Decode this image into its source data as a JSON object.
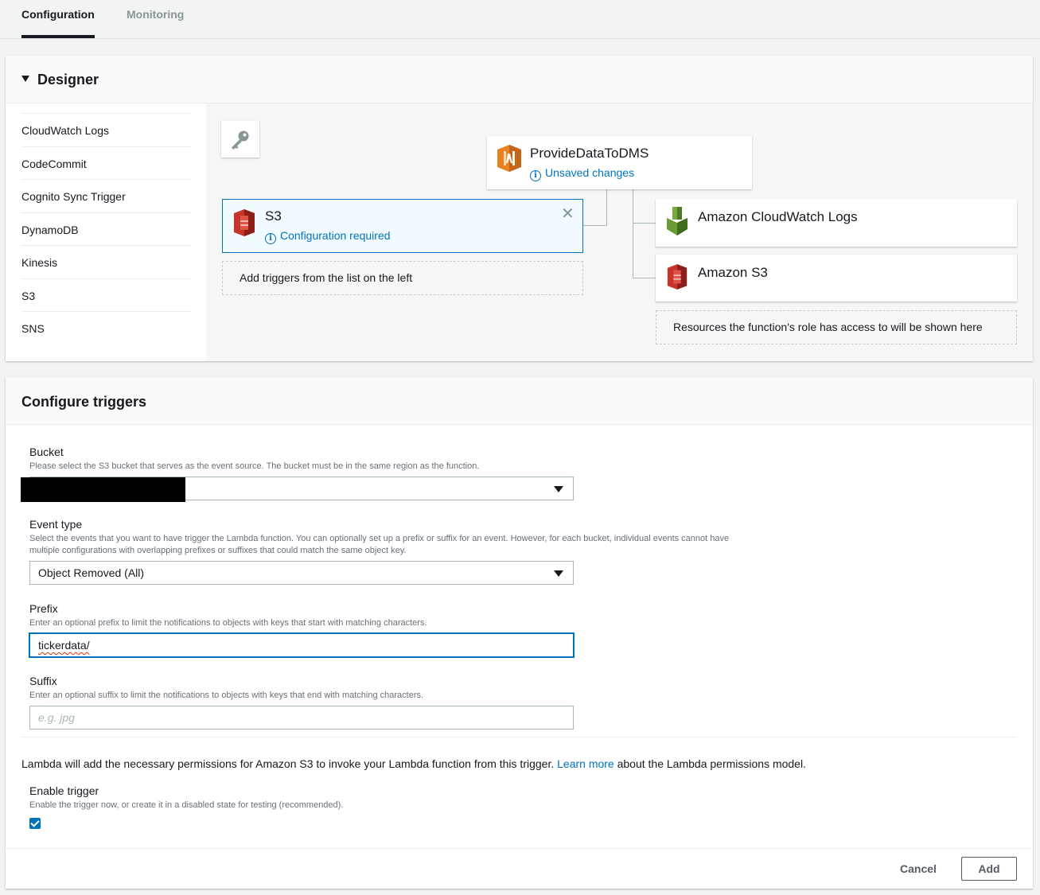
{
  "tabs": [
    {
      "label": "Configuration",
      "active": true
    },
    {
      "label": "Monitoring",
      "active": false
    }
  ],
  "designer": {
    "title": "Designer",
    "triggers": [
      "CloudWatch Logs",
      "CodeCommit",
      "Cognito Sync Trigger",
      "DynamoDB",
      "Kinesis",
      "S3",
      "SNS"
    ],
    "function": {
      "name": "ProvideDataToDMS",
      "status": "Unsaved changes"
    },
    "trigger_card": {
      "name": "S3",
      "status": "Configuration required"
    },
    "add_triggers_hint": "Add triggers from the list on the left",
    "resources": [
      "Amazon CloudWatch Logs",
      "Amazon S3"
    ],
    "resources_hint": "Resources the function's role has access to will be shown here"
  },
  "configure": {
    "title": "Configure triggers",
    "bucket": {
      "label": "Bucket",
      "desc": "Please select the S3 bucket that serves as the event source. The bucket must be in the same region as the function.",
      "value": ""
    },
    "event_type": {
      "label": "Event type",
      "desc": "Select the events that you want to have trigger the Lambda function. You can optionally set up a prefix or suffix for an event. However, for each bucket, individual events cannot have multiple configurations with overlapping prefixes or suffixes that could match the same object key.",
      "value": "Object Removed (All)"
    },
    "prefix": {
      "label": "Prefix",
      "desc": "Enter an optional prefix to limit the notifications to objects with keys that start with matching characters.",
      "value": "tickerdata/"
    },
    "suffix": {
      "label": "Suffix",
      "desc": "Enter an optional suffix to limit the notifications to objects with keys that end with matching characters.",
      "placeholder": "e.g. jpg"
    },
    "permissions": {
      "before": "Lambda will add the necessary permissions for Amazon S3 to invoke your Lambda function from this trigger. ",
      "link": "Learn more",
      "after": " about the Lambda permissions model."
    },
    "enable_trigger": {
      "label": "Enable trigger",
      "desc": "Enable the trigger now, or create it in a disabled state for testing (recommended).",
      "checked": true
    },
    "cancel_label": "Cancel",
    "add_label": "Add"
  },
  "colors": {
    "link": "#0073bb",
    "lambda_orange": "#e7821f",
    "s3_red": "#c7342b",
    "cloudwatch_green": "#6b9b37"
  }
}
